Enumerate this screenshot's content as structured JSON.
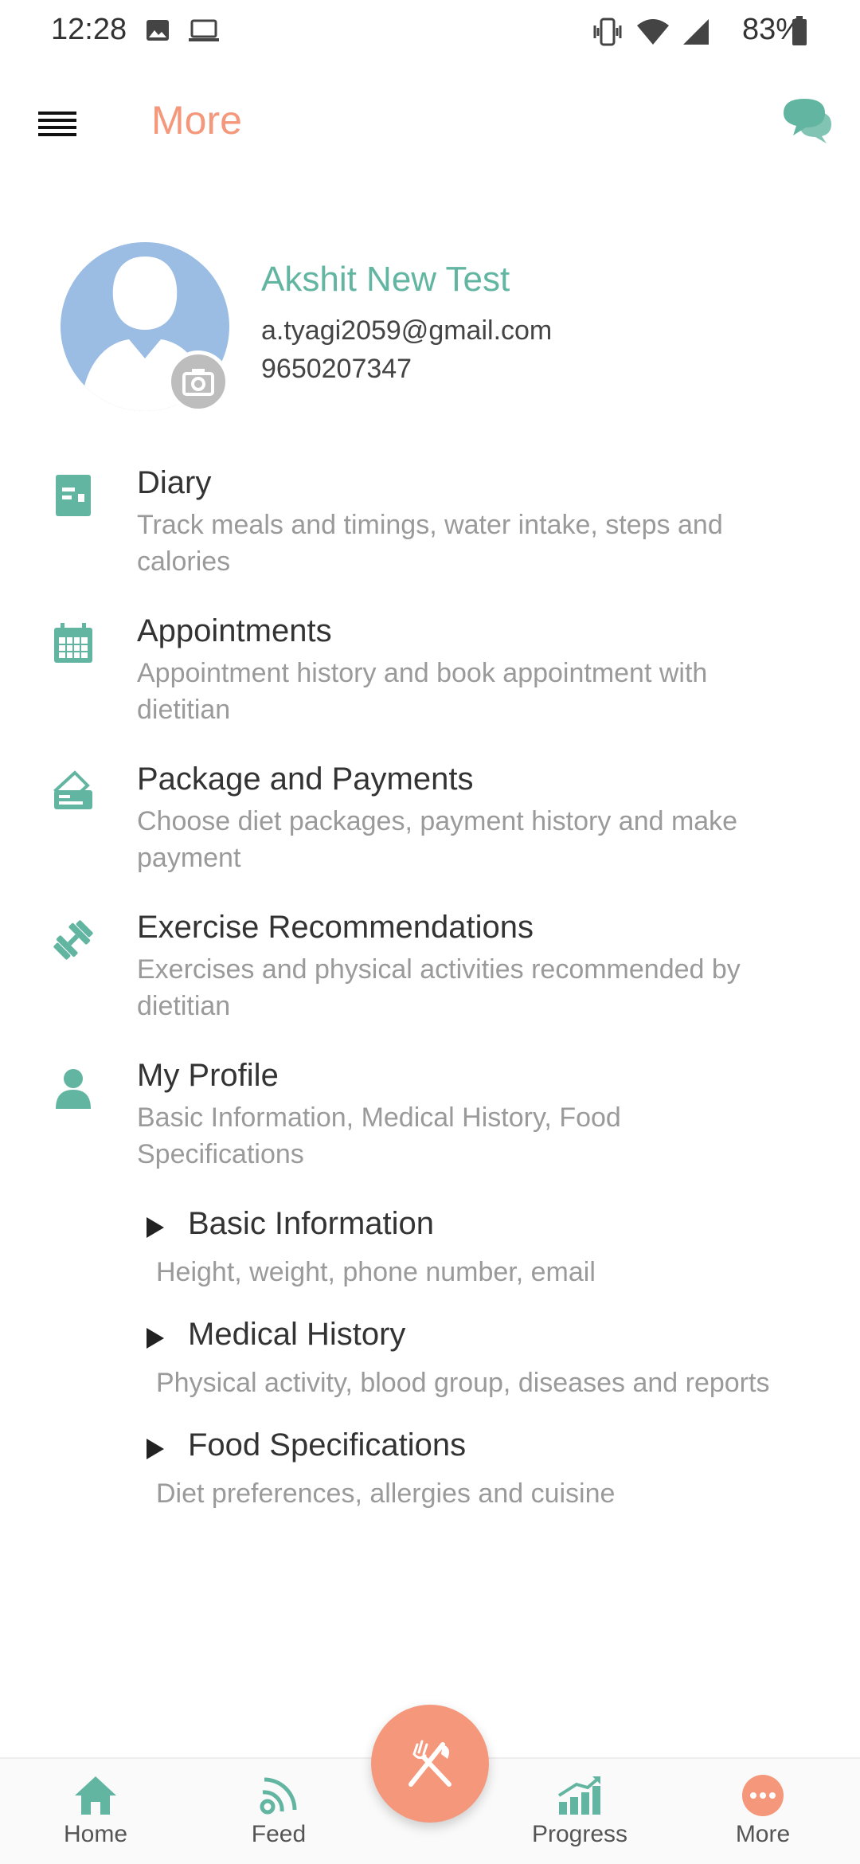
{
  "status_bar": {
    "time": "12:28",
    "battery": "83%",
    "icons": [
      "image-icon",
      "laptop-icon",
      "vibrate-icon",
      "wifi-icon",
      "signal-icon",
      "battery-icon"
    ]
  },
  "header": {
    "title": "More",
    "menu_icon": "hamburger-menu-icon",
    "chat_icon": "chat-bubbles-icon"
  },
  "profile": {
    "name": "Akshit New Test",
    "email": "a.tyagi2059@gmail.com",
    "phone": "9650207347"
  },
  "menu": {
    "items": [
      {
        "title": "Diary",
        "desc": "Track meals and timings, water intake, steps and calories",
        "icon": "diary-icon"
      },
      {
        "title": "Appointments",
        "desc": "Appointment history and book appointment with dietitian",
        "icon": "calendar-icon"
      },
      {
        "title": "Package and Payments",
        "desc": "Choose diet packages, payment history and make payment",
        "icon": "payment-icon"
      },
      {
        "title": "Exercise Recommendations",
        "desc": "Exercises and physical activities recommended by dietitian",
        "icon": "dumbbell-icon"
      },
      {
        "title": "My Profile",
        "desc": "Basic Information, Medical History, Food Specifications",
        "icon": "person-icon"
      }
    ],
    "sub_items": [
      {
        "title": "Basic Information",
        "desc": "Height, weight, phone number, email"
      },
      {
        "title": "Medical History",
        "desc": "Physical activity, blood group, diseases and reports"
      },
      {
        "title": "Food Specifications",
        "desc": "Diet preferences, allergies and cuisine"
      }
    ]
  },
  "bottom_nav": {
    "items": [
      {
        "label": "Home",
        "icon": "home-icon"
      },
      {
        "label": "Feed",
        "icon": "feed-icon"
      },
      {
        "label": "Progress",
        "icon": "progress-icon"
      },
      {
        "label": "More",
        "icon": "more-icon"
      }
    ],
    "fab_icon": "fork-knife-icon"
  },
  "colors": {
    "accent": "#f5977b",
    "teal": "#62b5a0",
    "avatar": "#9bbde3"
  }
}
